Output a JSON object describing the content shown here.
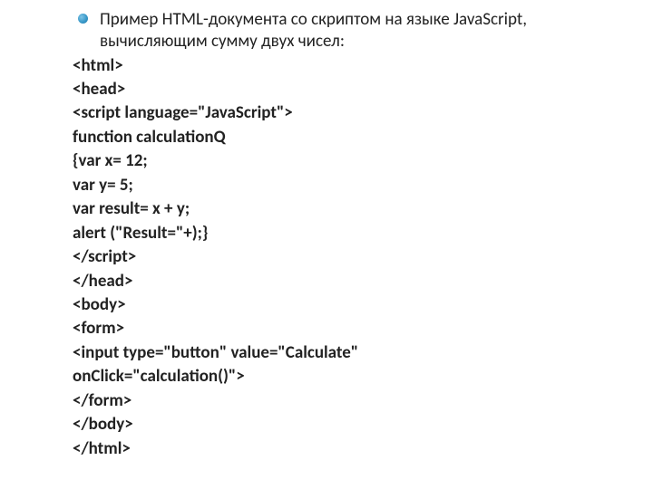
{
  "intro": "Пример HTML-документа со скриптом на языке JavaScript, вычисляющим сумму двух чисел:",
  "code": {
    "l1": "<html>",
    "l2": "<head>",
    "l3": "<script language=\"JavaScript\">",
    "l4": "function calculationQ",
    "l5": "{var x= 12;",
    "l6": "var y= 5;",
    "l7": "var result= x + y;",
    "l8": "alert (\"Result=\"+);}",
    "l9": "</script>",
    "l10": "</head>",
    "l11": "<body>",
    "l12": "<form>",
    "l13": "<input type=\"button\" value=\"Calculate\"",
    "l14": "onClick=\"calculation()\">",
    "l15": "</form>",
    "l16": "</body>",
    "l17": "</html>"
  }
}
